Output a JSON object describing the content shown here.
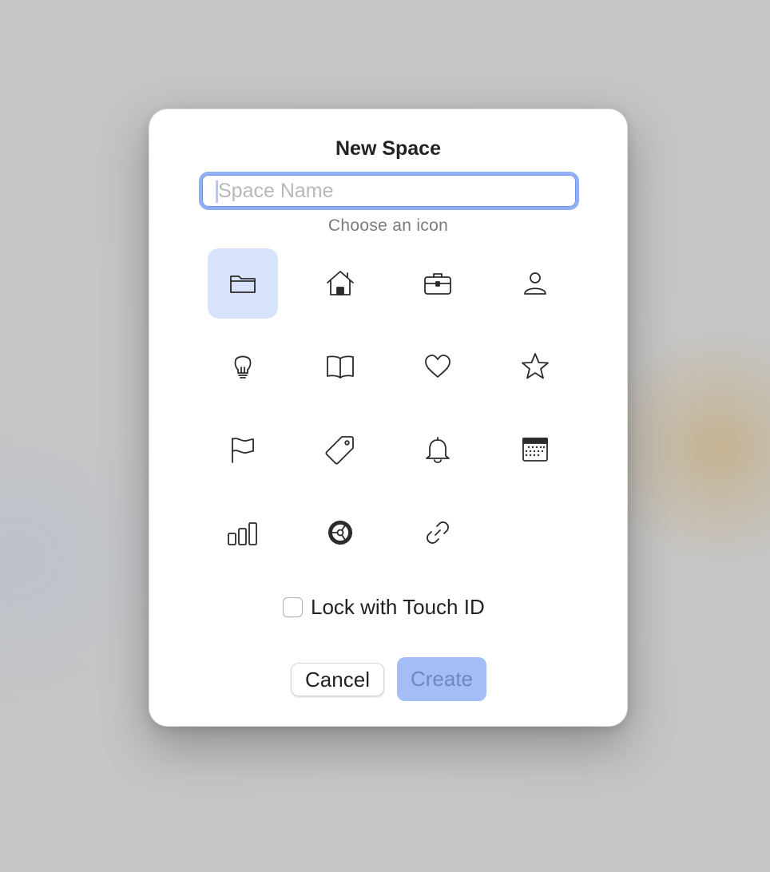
{
  "dialog": {
    "title": "New Space",
    "name_input": {
      "value": "",
      "placeholder": "Space Name"
    },
    "icon_prompt": "Choose an icon",
    "selected_icon": "folder",
    "icons": [
      "folder",
      "house",
      "briefcase",
      "person",
      "lightbulb",
      "book",
      "heart",
      "star",
      "flag",
      "tag",
      "bell",
      "calendar",
      "chart-bar",
      "gear",
      "link"
    ],
    "lock": {
      "label": "Lock with Touch ID",
      "checked": false
    },
    "buttons": {
      "cancel": "Cancel",
      "create": "Create"
    }
  },
  "colors": {
    "accent": "#8fb0f4",
    "selected_tile": "#d6e3fb",
    "create_button_disabled": "#a4bdf7"
  }
}
